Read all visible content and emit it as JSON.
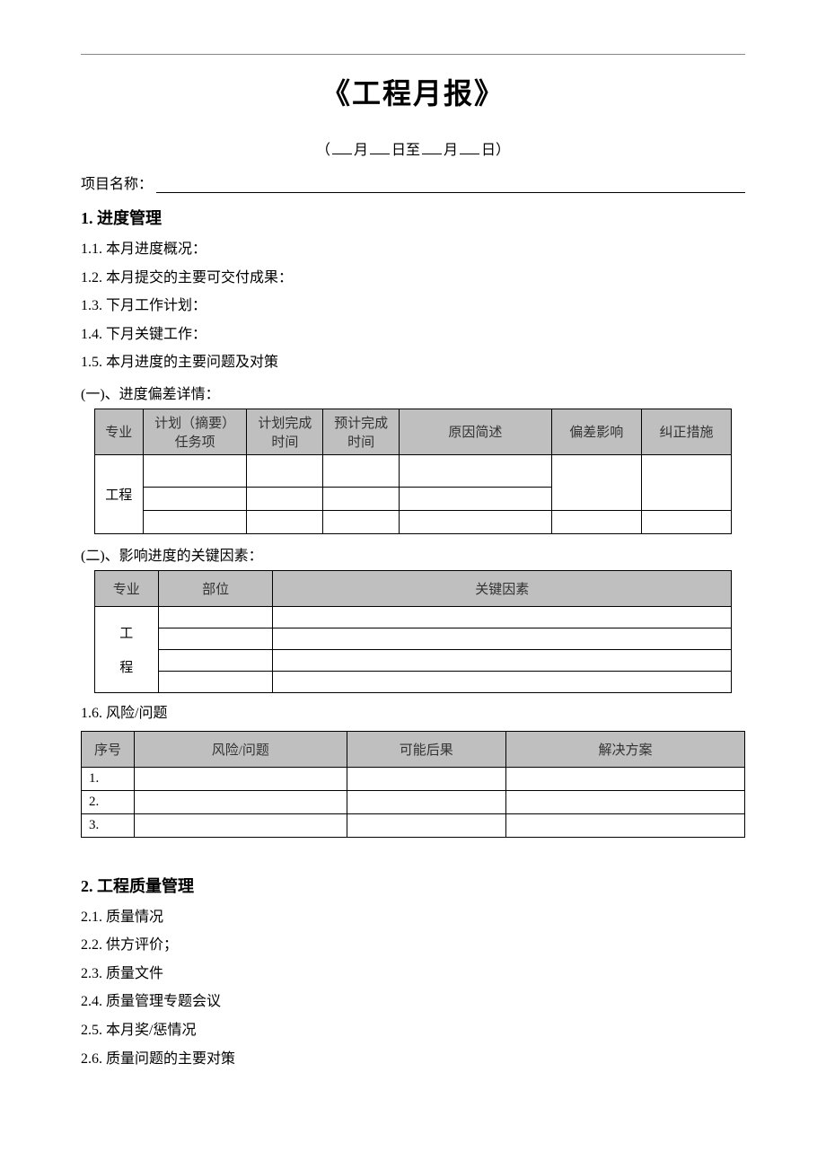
{
  "title": "《工程月报》",
  "subtitle_parts": {
    "p1": "（",
    "m1": "月",
    "d1": "日至",
    "m2": "月",
    "d2": "日）"
  },
  "project_label": "项目名称：",
  "section1": {
    "heading": "1. 进度管理",
    "i1": "1.1. 本月进度概况：",
    "i2": "1.2. 本月提交的主要可交付成果：",
    "i3": "1.3. 下月工作计划：",
    "i4": "1.4. 下月关键工作：",
    "i5": "1.5. 本月进度的主要问题及对策",
    "sub1": "(一)、进度偏差详情：",
    "t1_headers": {
      "c1": "专业",
      "c2": "计划（摘要）任务项",
      "c3": "计划完成时间",
      "c4": "预计完成时间",
      "c5": "原因简述",
      "c6": "偏差影响",
      "c7": "纠正措施"
    },
    "t1_rowlabel": "工程",
    "sub2": "(二)、影响进度的关键因素：",
    "t2_headers": {
      "c1": "专业",
      "c2": "部位",
      "c3": "关键因素"
    },
    "t2_rowlabel": "工",
    "t2_rowlabel2": "程",
    "i6": "1.6. 风险/问题",
    "t3_headers": {
      "c1": "序号",
      "c2": "风险/问题",
      "c3": "可能后果",
      "c4": "解决方案"
    },
    "t3_rows": [
      "1.",
      "2.",
      "3."
    ]
  },
  "section2": {
    "heading": "2. 工程质量管理",
    "i1": "2.1. 质量情况",
    "i2": "2.2. 供方评价；",
    "i3": "2.3. 质量文件",
    "i4": "2.4. 质量管理专题会议",
    "i5": "2.5. 本月奖/惩情况",
    "i6": "2.6. 质量问题的主要对策"
  }
}
